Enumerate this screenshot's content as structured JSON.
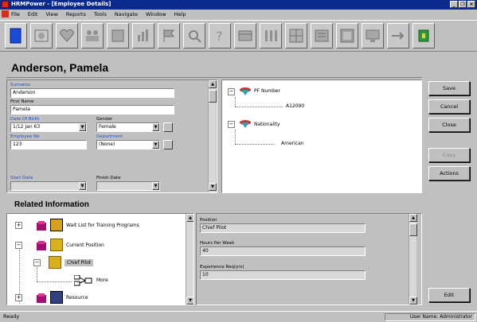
{
  "window": {
    "title": "HRMPower - [Employee Details]"
  },
  "menu": [
    "File",
    "Edit",
    "View",
    "Reports",
    "Tools",
    "Navigate",
    "Window",
    "Help"
  ],
  "toolbar": {
    "icons": [
      "new-document-icon",
      "view-icon",
      "heart-icon",
      "people-icon",
      "disk-icon",
      "chart-icon",
      "flag-icon",
      "search-icon",
      "help-icon",
      "calendar-icon",
      "columns-icon",
      "grid-icon",
      "report-icon",
      "grid2-icon",
      "monitor-icon",
      "navigate-icon",
      "exit-icon"
    ]
  },
  "employee": {
    "name": "Anderson, Pamela"
  },
  "form": {
    "surname_label": "Surname",
    "surname": "Anderson",
    "firstname_label": "First Name",
    "firstname": "Pamela",
    "dob_label": "Date Of Birth",
    "dob": "1/12 Jan 63",
    "gender_label": "Gender",
    "gender": "Female",
    "empno_label": "Employee No",
    "empno": "123",
    "dept_label": "Department",
    "dept": "(None)",
    "start_label": "Start Date",
    "start": "",
    "finish_label": "Finish Date",
    "finish": ""
  },
  "tree": {
    "n1": "PF Number",
    "n1v": "A12090",
    "n2": "Nationality",
    "n2v": "American"
  },
  "buttons": {
    "save": "Save",
    "cancel": "Cancel",
    "close": "Close",
    "copy": "Copy",
    "actions": "Actions",
    "edit": "Edit"
  },
  "related": {
    "title": "Related Information",
    "items": [
      "Wait List for Training Programs",
      "Current Position",
      "Chief Pilot",
      "More",
      "Resource"
    ]
  },
  "details": {
    "position_label": "Position",
    "position": "Chief Pilot",
    "hours_label": "Hours Per Week",
    "hours": "40",
    "exp_label": "Experience Req(yrs)",
    "exp": "10"
  },
  "status": {
    "left": "Ready",
    "right": "User Name: Administrator"
  },
  "colors": {
    "titlebar": "#0a2a8e",
    "label_blue": "#2050c8",
    "face": "#c0c0c0"
  }
}
